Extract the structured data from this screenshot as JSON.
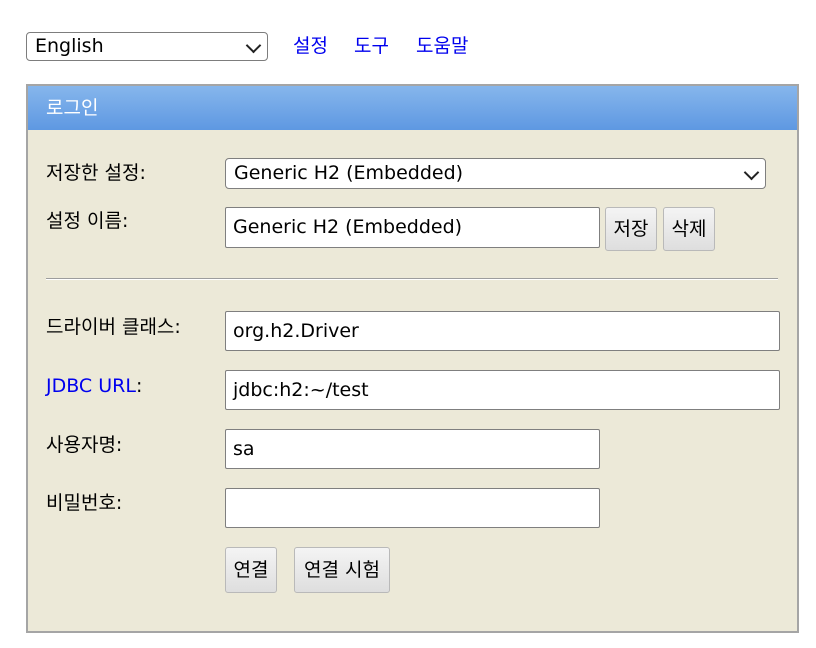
{
  "top": {
    "language": "English",
    "links": {
      "settings": "설정",
      "tools": "도구",
      "help": "도움말"
    }
  },
  "panel": {
    "title": "로그인",
    "saved_settings": {
      "label": "저장한 설정:",
      "value": "Generic H2 (Embedded)"
    },
    "setting_name": {
      "label": "설정 이름:",
      "value": "Generic H2 (Embedded)",
      "save_button": "저장",
      "delete_button": "삭제"
    },
    "driver_class": {
      "label": "드라이버 클래스:",
      "value": "org.h2.Driver"
    },
    "jdbc_url": {
      "label": "JDBC URL",
      "label_suffix": ":",
      "value": "jdbc:h2:~/test"
    },
    "username": {
      "label": "사용자명:",
      "value": "sa"
    },
    "password": {
      "label": "비밀번호:",
      "value": ""
    },
    "buttons": {
      "connect": "연결",
      "test_connection": "연결 시험"
    }
  }
}
